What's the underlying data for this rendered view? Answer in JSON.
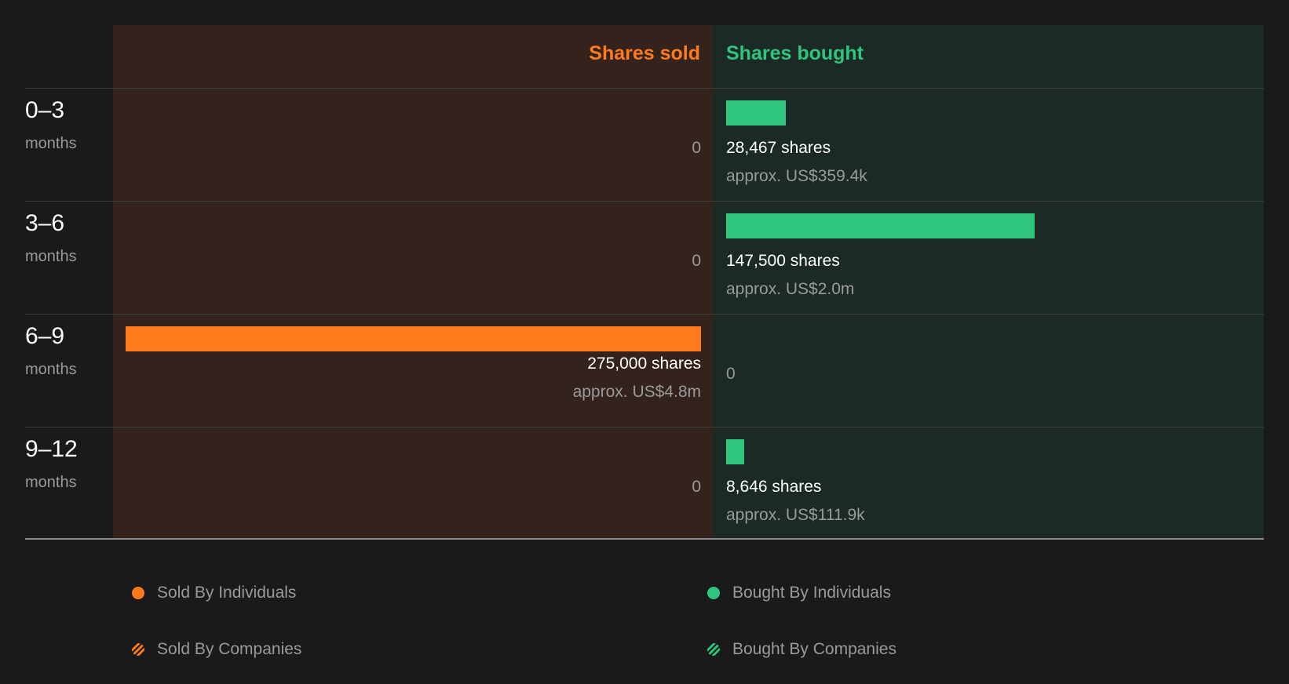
{
  "colors": {
    "sold": "#ff7a1a",
    "bought": "#2ec57e",
    "sold_panel": "#33231c",
    "bought_panel": "#1b2a24"
  },
  "chart_data": {
    "type": "bar",
    "header": {
      "sold": "Shares sold",
      "bought": "Shares bought"
    },
    "categories": [
      {
        "period": "0–3",
        "unit": "months"
      },
      {
        "period": "3–6",
        "unit": "months"
      },
      {
        "period": "6–9",
        "unit": "months"
      },
      {
        "period": "9–12",
        "unit": "months"
      }
    ],
    "series": [
      {
        "name": "Shares sold",
        "values": [
          0,
          0,
          275000,
          0
        ],
        "shares_labels": [
          "0",
          "0",
          "275,000 shares",
          "0"
        ],
        "value_labels": [
          "",
          "",
          "approx. US$4.8m",
          ""
        ]
      },
      {
        "name": "Shares bought",
        "values": [
          28467,
          147500,
          0,
          8646
        ],
        "shares_labels": [
          "28,467 shares",
          "147,500 shares",
          "0",
          "8,646 shares"
        ],
        "value_labels": [
          "approx. US$359.4k",
          "approx. US$2.0m",
          "",
          "approx. US$111.9k"
        ]
      }
    ],
    "xlim": [
      0,
      275000
    ],
    "legend": [
      {
        "label": "Sold By Individuals",
        "icon": "solid-dot",
        "color": "#ff7a1a"
      },
      {
        "label": "Bought By Individuals",
        "icon": "solid-dot",
        "color": "#2ec57e"
      },
      {
        "label": "Sold By Companies",
        "icon": "hatched-dot",
        "color": "#ff7a1a"
      },
      {
        "label": "Bought By Companies",
        "icon": "hatched-dot",
        "color": "#2ec57e"
      }
    ]
  }
}
